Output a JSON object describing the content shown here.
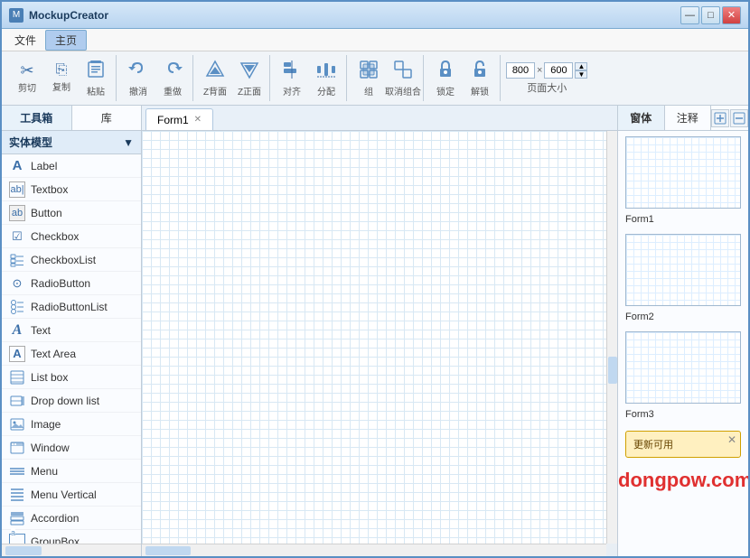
{
  "window": {
    "title": "MockupCreator",
    "controls": {
      "minimize": "—",
      "maximize": "□",
      "close": "✕"
    }
  },
  "menubar": {
    "items": [
      {
        "label": "文件",
        "active": false
      },
      {
        "label": "主页",
        "active": true
      }
    ]
  },
  "toolbar": {
    "groups": [
      {
        "buttons": [
          {
            "label": "剪切",
            "icon": "✂"
          },
          {
            "label": "复制",
            "icon": "⎘"
          },
          {
            "label": "粘贴",
            "icon": "📋"
          }
        ]
      },
      {
        "buttons": [
          {
            "label": "撤消",
            "icon": "↩"
          },
          {
            "label": "重做",
            "icon": "↪"
          }
        ]
      },
      {
        "buttons": [
          {
            "label": "Z背面",
            "icon": "△"
          },
          {
            "label": "Z正面",
            "icon": "▽"
          }
        ]
      },
      {
        "buttons": [
          {
            "label": "对齐",
            "icon": "⊞"
          },
          {
            "label": "分配",
            "icon": "⋯"
          }
        ]
      },
      {
        "buttons": [
          {
            "label": "组",
            "icon": "▣"
          },
          {
            "label": "取消组合",
            "icon": "◫"
          }
        ]
      },
      {
        "buttons": [
          {
            "label": "锁定",
            "icon": "🔒"
          },
          {
            "label": "解锁",
            "icon": "🔓"
          }
        ]
      }
    ],
    "size": {
      "width": "800",
      "height": "600",
      "separator": "×",
      "label": "页面大小"
    }
  },
  "sidebar": {
    "tabs": [
      {
        "label": "工具箱",
        "active": true
      },
      {
        "label": "库",
        "active": false
      }
    ],
    "category": "实体模型",
    "items": [
      {
        "label": "Label",
        "icon": "A",
        "icon_type": "text"
      },
      {
        "label": "Textbox",
        "icon": "ab|",
        "icon_type": "text"
      },
      {
        "label": "Button",
        "icon": "ab",
        "icon_type": "box"
      },
      {
        "label": "Checkbox",
        "icon": "☑",
        "icon_type": "text"
      },
      {
        "label": "CheckboxList",
        "icon": "☰",
        "icon_type": "text"
      },
      {
        "label": "RadioButton",
        "icon": "⊙",
        "icon_type": "text"
      },
      {
        "label": "RadioButtonList",
        "icon": "⋮",
        "icon_type": "text"
      },
      {
        "label": "Text",
        "icon": "A",
        "icon_type": "cursive"
      },
      {
        "label": "Text Area",
        "icon": "A",
        "icon_type": "boxed"
      },
      {
        "label": "List box",
        "icon": "≡",
        "icon_type": "text"
      },
      {
        "label": "Drop down list",
        "icon": "⊟",
        "icon_type": "text"
      },
      {
        "label": "Image",
        "icon": "🖼",
        "icon_type": "text"
      },
      {
        "label": "Window",
        "icon": "⊡",
        "icon_type": "text"
      },
      {
        "label": "Menu",
        "icon": "☰",
        "icon_type": "text"
      },
      {
        "label": "Menu Vertical",
        "icon": "☰",
        "icon_type": "text"
      },
      {
        "label": "Accordion",
        "icon": "≣",
        "icon_type": "text"
      },
      {
        "label": "GroupBox",
        "icon": "a",
        "icon_type": "boxed"
      }
    ]
  },
  "canvas": {
    "tab": "Form1"
  },
  "right_panel": {
    "tabs": [
      {
        "label": "窗体",
        "active": true
      },
      {
        "label": "注释",
        "active": false
      }
    ],
    "forms": [
      {
        "label": "Form1"
      },
      {
        "label": "Form2"
      },
      {
        "label": "Form3"
      }
    ],
    "update_banner": {
      "text": "更新可用",
      "close": "✕"
    }
  },
  "watermark": {
    "text": "dongpow.com"
  }
}
